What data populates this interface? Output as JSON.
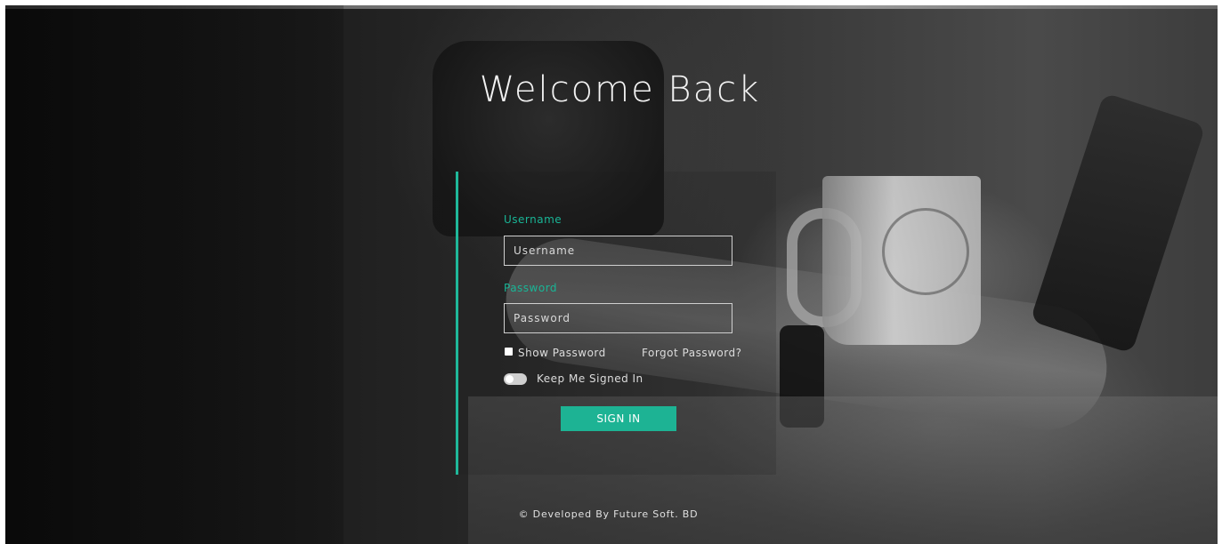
{
  "page": {
    "title": "Welcome Back"
  },
  "login": {
    "username_label": "Username",
    "username_placeholder": "Username",
    "username_value": "",
    "password_label": "Password",
    "password_placeholder": "Password",
    "password_value": "",
    "show_password_label": "Show Password",
    "show_password_checked": false,
    "forgot_password_link": "Forgot Password?",
    "keep_signed_in_label": "Keep Me Signed In",
    "keep_signed_in_on": false,
    "sign_in_button": "SIGN IN"
  },
  "footer": {
    "credit": "© Developed By Future Soft. BD"
  },
  "colors": {
    "accent": "#1db394",
    "text_light": "#f2f2f2"
  },
  "icons": {
    "checkbox": "checkbox-icon",
    "toggle": "toggle-switch"
  }
}
